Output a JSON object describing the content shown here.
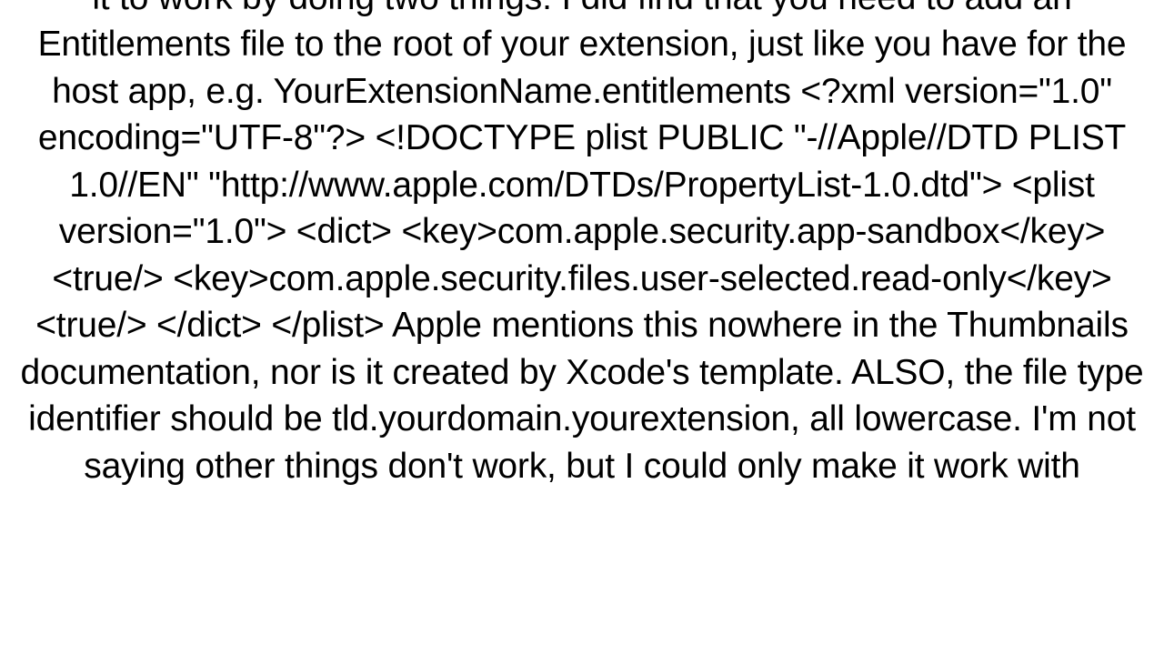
{
  "document": {
    "body_text": "it to work by doing two things:  I did find that you need to add an Entitlements file to the root of your extension, just like you have for the host app, e.g. YourExtensionName.entitlements <?xml version=\"1.0\" encoding=\"UTF-8\"?> <!DOCTYPE plist PUBLIC \"-//Apple//DTD PLIST 1.0//EN\" \"http://www.apple.com/DTDs/PropertyList-1.0.dtd\"> <plist version=\"1.0\"> <dict>     <key>com.apple.security.app-sandbox</key>     <true/>     <key>com.apple.security.files.user-selected.read-only</key>     <true/> </dict> </plist>  Apple mentions this nowhere in the Thumbnails documentation, nor is it created by Xcode's template.  ALSO, the file type identifier should be tld.yourdomain.yourextension, all lowercase. I'm not saying other things don't work, but I could only make it work with"
  }
}
